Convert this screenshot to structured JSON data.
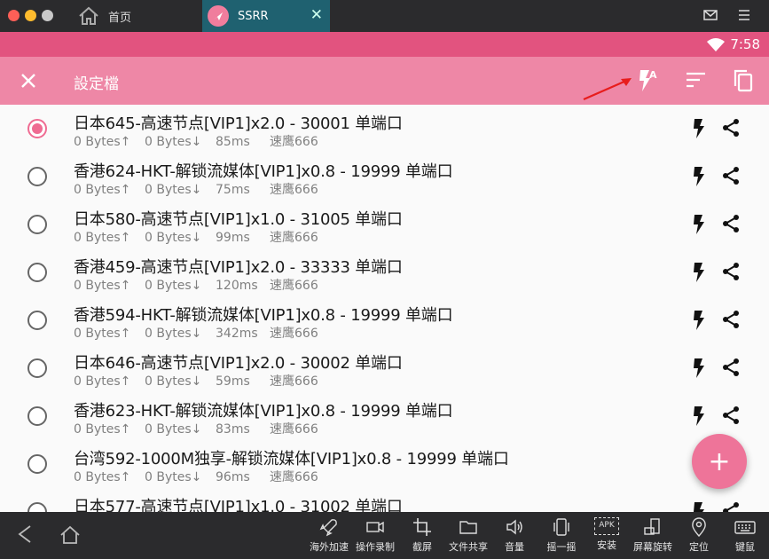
{
  "emulator": {
    "tabs": [
      {
        "label": "首页",
        "icon": "home-icon"
      },
      {
        "label": "SSRR",
        "icon": "app-icon",
        "close": "✕"
      }
    ],
    "bottom_tools": [
      {
        "label": "海外加速",
        "icon": "rocket-icon"
      },
      {
        "label": "操作录制",
        "icon": "video-record-icon"
      },
      {
        "label": "截屏",
        "icon": "crop-icon"
      },
      {
        "label": "文件共享",
        "icon": "folder-icon"
      },
      {
        "label": "音量",
        "icon": "volume-icon"
      },
      {
        "label": "摇一摇",
        "icon": "shake-icon"
      },
      {
        "label": "安装",
        "icon": "apk-install-icon"
      },
      {
        "label": "屏幕旋转",
        "icon": "rotate-icon"
      },
      {
        "label": "定位",
        "icon": "location-icon"
      },
      {
        "label": "键鼠",
        "icon": "keyboard-icon"
      }
    ],
    "apk_label": "APK"
  },
  "status_bar": {
    "time": "7:58"
  },
  "toolbar": {
    "title": "設定檔",
    "bolt_badge": "A"
  },
  "profiles": [
    {
      "title": "日本645-高速节点[VIP1]x2.0 - 30001 单端口",
      "up": "0 Bytes↑",
      "down": "0 Bytes↓",
      "latency": "85ms",
      "group": "速鹰666",
      "selected": true
    },
    {
      "title": "香港624-HKT-解锁流媒体[VIP1]x0.8 - 19999 单端口",
      "up": "0 Bytes↑",
      "down": "0 Bytes↓",
      "latency": "75ms",
      "group": "速鹰666",
      "selected": false
    },
    {
      "title": "日本580-高速节点[VIP1]x1.0 - 31005 单端口",
      "up": "0 Bytes↑",
      "down": "0 Bytes↓",
      "latency": "99ms",
      "group": "速鹰666",
      "selected": false
    },
    {
      "title": "香港459-高速节点[VIP1]x2.0 - 33333 单端口",
      "up": "0 Bytes↑",
      "down": "0 Bytes↓",
      "latency": "120ms",
      "group": "速鹰666",
      "selected": false
    },
    {
      "title": "香港594-HKT-解锁流媒体[VIP1]x0.8 - 19999 单端口",
      "up": "0 Bytes↑",
      "down": "0 Bytes↓",
      "latency": "342ms",
      "group": "速鹰666",
      "selected": false
    },
    {
      "title": "日本646-高速节点[VIP1]x2.0 - 30002 单端口",
      "up": "0 Bytes↑",
      "down": "0 Bytes↓",
      "latency": "59ms",
      "group": "速鹰666",
      "selected": false
    },
    {
      "title": "香港623-HKT-解锁流媒体[VIP1]x0.8 - 19999 单端口",
      "up": "0 Bytes↑",
      "down": "0 Bytes↓",
      "latency": "83ms",
      "group": "速鹰666",
      "selected": false
    },
    {
      "title": "台湾592-1000M独享-解锁流媒体[VIP1]x0.8 - 19999 单端口",
      "up": "0 Bytes↑",
      "down": "0 Bytes↓",
      "latency": "96ms",
      "group": "速鹰666",
      "selected": false
    },
    {
      "title": "日本577-高速节点[VIP1]x1.0 - 31002 单端口",
      "up": "",
      "down": "",
      "latency": "",
      "group": "",
      "selected": false
    }
  ],
  "fab": {
    "label": "+"
  },
  "colors": {
    "status_bar": "#e2537f",
    "toolbar": "#ee87a6",
    "accent": "#ef6b92",
    "emulator_chrome": "#2b2b2d",
    "active_tab": "#1f6170"
  }
}
